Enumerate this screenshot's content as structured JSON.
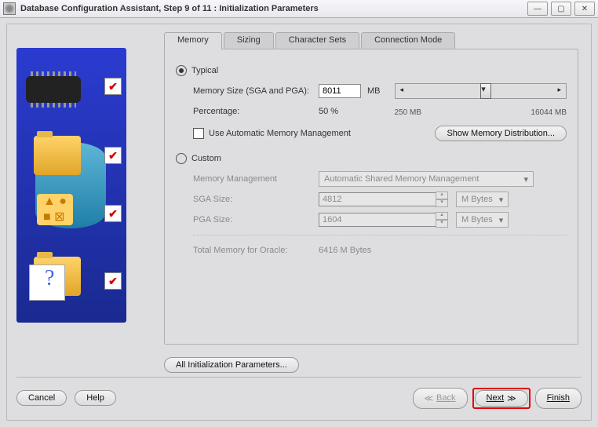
{
  "window": {
    "title": "Database Configuration Assistant, Step 9 of 11 : Initialization Parameters"
  },
  "tabs": {
    "memory": "Memory",
    "sizing": "Sizing",
    "charsets": "Character Sets",
    "connmode": "Connection Mode"
  },
  "typical": {
    "radio_label": "Typical",
    "memsize_label": "Memory Size (SGA and PGA):",
    "memsize_value": "8011",
    "memsize_unit": "MB",
    "percentage_label": "Percentage:",
    "percentage_value": "50 %",
    "slider_min": "250 MB",
    "slider_max": "16044 MB",
    "amm_label": "Use Automatic Memory Management",
    "show_dist": "Show Memory Distribution..."
  },
  "custom": {
    "radio_label": "Custom",
    "mm_label": "Memory Management",
    "mm_value": "Automatic Shared Memory Management",
    "sga_label": "SGA Size:",
    "sga_value": "4812",
    "pga_label": "PGA Size:",
    "pga_value": "1604",
    "unit": "M Bytes",
    "total_label": "Total Memory for Oracle:",
    "total_value": "6416 M Bytes"
  },
  "buttons": {
    "all_params": "All Initialization Parameters...",
    "cancel": "Cancel",
    "help": "Help",
    "back": "Back",
    "next": "Next",
    "finish": "Finish"
  }
}
